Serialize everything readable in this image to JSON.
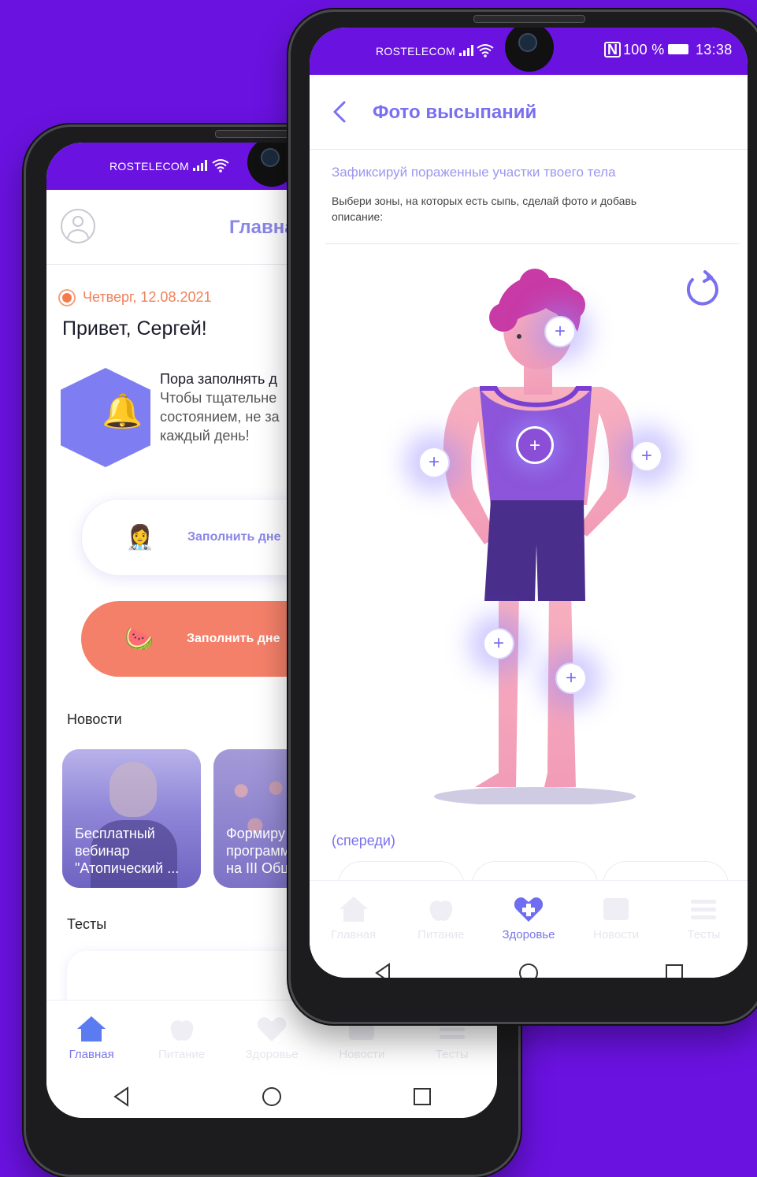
{
  "back_phone": {
    "status": {
      "carrier": "ROSTELECOM"
    },
    "header": {
      "title": "Главная"
    },
    "date": "Четверг, 12.08.2021",
    "greeting": "Привет, Сергей!",
    "reminder": {
      "line1": "Пора заполнять д",
      "line2": "Чтобы тщательне",
      "line3": "состоянием, не за",
      "line4": "каждый день!"
    },
    "actions": [
      {
        "label": "Заполнить дне",
        "icon": "doctor-icon"
      },
      {
        "label": "Заполнить дне",
        "icon": "watermelon-icon"
      }
    ],
    "news_title": "Новости",
    "news": [
      {
        "caption_lines": [
          "Бесплатный",
          "вебинар",
          "\"Атопический ..."
        ]
      },
      {
        "caption_lines": [
          "Формиру",
          "программ",
          "на III Обц"
        ]
      }
    ],
    "tests_title": "Тесты",
    "nav": [
      {
        "label": "Главная",
        "icon": "home-icon",
        "active": true
      },
      {
        "label": "Питание",
        "icon": "apple-icon",
        "active": false
      },
      {
        "label": "Здоровье",
        "icon": "heart-plus-icon",
        "active": false
      },
      {
        "label": "Новости",
        "icon": "news-icon",
        "active": false
      },
      {
        "label": "Тесты",
        "icon": "list-icon",
        "active": false
      }
    ]
  },
  "front_phone": {
    "status": {
      "carrier": "ROSTELECOM",
      "nfc": "N",
      "battery": "100 %",
      "time": "13:38"
    },
    "header": {
      "title": "Фото высыпаний"
    },
    "subtitle": "Зафиксируй пораженные участки твоего тела",
    "description": "Выбери зоны, на которых есть сыпь, сделай фото и добавь описание:",
    "view_label": "(спереди)",
    "add_points": [
      "+",
      "+",
      "+",
      "+",
      "+",
      "+"
    ],
    "nav": [
      {
        "label": "Главная",
        "icon": "home-icon",
        "active": false
      },
      {
        "label": "Питание",
        "icon": "apple-icon",
        "active": false
      },
      {
        "label": "Здоровье",
        "icon": "heart-plus-icon",
        "active": true
      },
      {
        "label": "Новости",
        "icon": "news-icon",
        "active": false
      },
      {
        "label": "Тесты",
        "icon": "list-icon",
        "active": false
      }
    ]
  },
  "colors": {
    "background": "#6a12e0",
    "accent": "#7a6ff0",
    "orange": "#f5806a",
    "status_bar": "#6a12e0"
  }
}
